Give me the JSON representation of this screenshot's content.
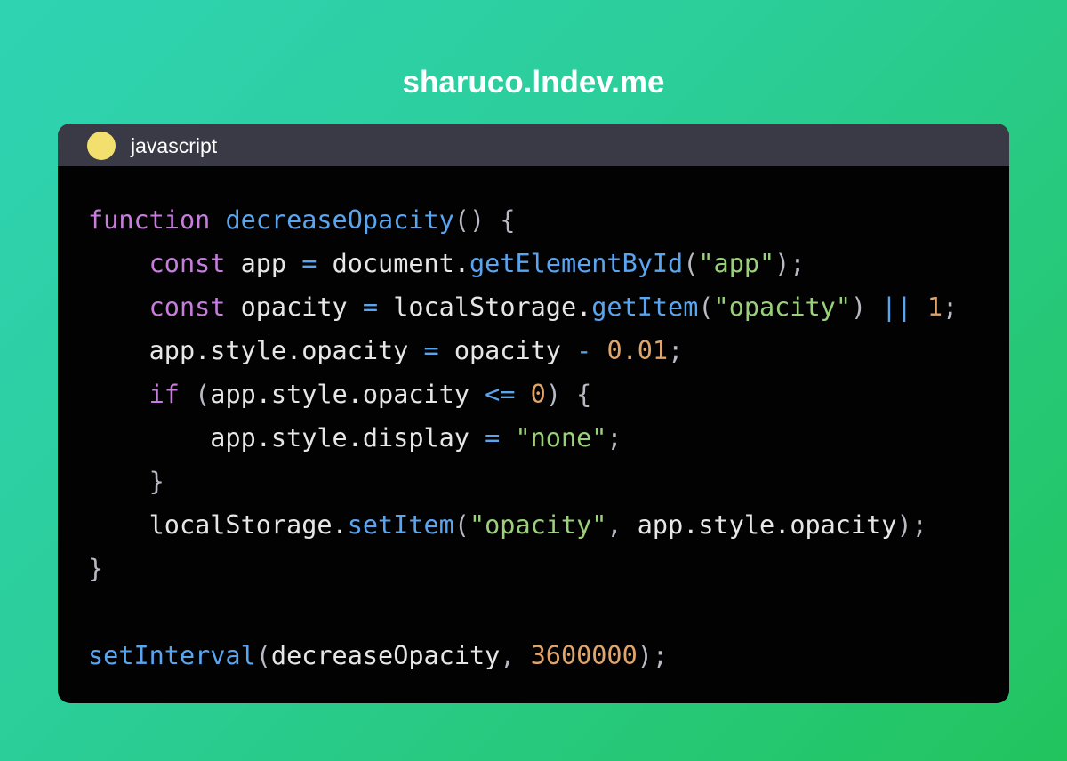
{
  "header": {
    "site_title": "sharuco.lndev.me"
  },
  "code_window": {
    "language": "javascript",
    "language_dot_color": "#f2df6e",
    "lines": [
      [
        {
          "t": "function",
          "k": "keyword"
        },
        {
          "t": " ",
          "k": "plain"
        },
        {
          "t": "decreaseOpacity",
          "k": "function"
        },
        {
          "t": "() {",
          "k": "punct"
        }
      ],
      [
        {
          "t": "    ",
          "k": "plain"
        },
        {
          "t": "const",
          "k": "keyword"
        },
        {
          "t": " app ",
          "k": "plain"
        },
        {
          "t": "=",
          "k": "operator"
        },
        {
          "t": " document.",
          "k": "plain"
        },
        {
          "t": "getElementById",
          "k": "function"
        },
        {
          "t": "(",
          "k": "punct"
        },
        {
          "t": "\"app\"",
          "k": "string"
        },
        {
          "t": ");",
          "k": "punct"
        }
      ],
      [
        {
          "t": "    ",
          "k": "plain"
        },
        {
          "t": "const",
          "k": "keyword"
        },
        {
          "t": " opacity ",
          "k": "plain"
        },
        {
          "t": "=",
          "k": "operator"
        },
        {
          "t": " localStorage.",
          "k": "plain"
        },
        {
          "t": "getItem",
          "k": "function"
        },
        {
          "t": "(",
          "k": "punct"
        },
        {
          "t": "\"opacity\"",
          "k": "string"
        },
        {
          "t": ") ",
          "k": "punct"
        },
        {
          "t": "||",
          "k": "operator"
        },
        {
          "t": " ",
          "k": "plain"
        },
        {
          "t": "1",
          "k": "number"
        },
        {
          "t": ";",
          "k": "punct"
        }
      ],
      [
        {
          "t": "    app.style.opacity ",
          "k": "plain"
        },
        {
          "t": "=",
          "k": "operator"
        },
        {
          "t": " opacity ",
          "k": "plain"
        },
        {
          "t": "-",
          "k": "operator"
        },
        {
          "t": " ",
          "k": "plain"
        },
        {
          "t": "0.01",
          "k": "number"
        },
        {
          "t": ";",
          "k": "punct"
        }
      ],
      [
        {
          "t": "    ",
          "k": "plain"
        },
        {
          "t": "if",
          "k": "keyword"
        },
        {
          "t": " (",
          "k": "punct"
        },
        {
          "t": "app.style.opacity ",
          "k": "plain"
        },
        {
          "t": "<=",
          "k": "operator"
        },
        {
          "t": " ",
          "k": "plain"
        },
        {
          "t": "0",
          "k": "number"
        },
        {
          "t": ") {",
          "k": "punct"
        }
      ],
      [
        {
          "t": "        app.style.display ",
          "k": "plain"
        },
        {
          "t": "=",
          "k": "operator"
        },
        {
          "t": " ",
          "k": "plain"
        },
        {
          "t": "\"none\"",
          "k": "string"
        },
        {
          "t": ";",
          "k": "punct"
        }
      ],
      [
        {
          "t": "    }",
          "k": "punct"
        }
      ],
      [
        {
          "t": "    localStorage.",
          "k": "plain"
        },
        {
          "t": "setItem",
          "k": "function"
        },
        {
          "t": "(",
          "k": "punct"
        },
        {
          "t": "\"opacity\"",
          "k": "string"
        },
        {
          "t": ", ",
          "k": "punct"
        },
        {
          "t": "app.style.opacity",
          "k": "plain"
        },
        {
          "t": ");",
          "k": "punct"
        }
      ],
      [
        {
          "t": "}",
          "k": "punct"
        }
      ],
      [],
      [
        {
          "t": "setInterval",
          "k": "function"
        },
        {
          "t": "(",
          "k": "punct"
        },
        {
          "t": "decreaseOpacity",
          "k": "plain"
        },
        {
          "t": ", ",
          "k": "punct"
        },
        {
          "t": "3600000",
          "k": "number"
        },
        {
          "t": ");",
          "k": "punct"
        }
      ]
    ]
  }
}
